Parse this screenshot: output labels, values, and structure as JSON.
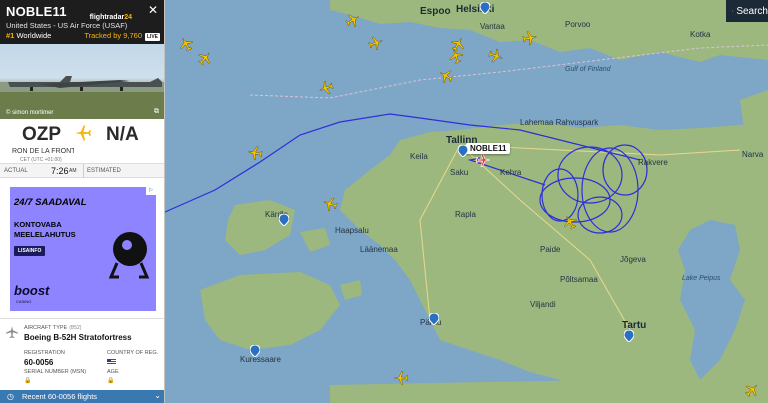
{
  "panel": {
    "callsign": "NOBLE11",
    "operator": "United States - US Air Force (USAF)",
    "rank_prefix": "#1",
    "rank_label": "Worldwide",
    "tracked_text": "Tracked by 9,760",
    "live_label": "LIVE",
    "logo_top": "flightradar",
    "logo_num": "24",
    "photo_credit": "© simon mortimer",
    "from_iata": "OZP",
    "to_iata": "N/A",
    "from_airport": "RON DE LA FRONT",
    "from_tz": "CET (UTC +01:00)",
    "actual_label": "ACTUAL",
    "actual_time": "7:26",
    "actual_ampm": "AM",
    "estimated_label": "ESTIMATED",
    "aircraft_type_label": "AIRCRAFT TYPE",
    "aircraft_type_code": "(B52)",
    "aircraft_type": "Boeing B-52H Stratofortress",
    "registration_label": "REGISTRATION",
    "registration": "60-0056",
    "country_label": "COUNTRY OF REG.",
    "serial_label": "SERIAL NUMBER (MSN)",
    "age_label": "AGE",
    "recent_label": "Recent 60-0056 flights"
  },
  "ad": {
    "line1": "24/7 SAADAVAL",
    "line2": "KONTOVABA",
    "line3": "MEELELAHUTUS",
    "button": "LISAINFO",
    "brand": "boost",
    "brand_sub": "CASINO"
  },
  "map": {
    "search_label": "Search",
    "flight_tag": "NOBLE11",
    "labels": [
      {
        "t": "Espoo",
        "c": "city"
      },
      {
        "t": "Helsinki",
        "c": "city"
      },
      {
        "t": "Tallinn",
        "c": "city"
      },
      {
        "t": "Tartu",
        "c": "city"
      },
      {
        "t": "Vantaa",
        "c": ""
      },
      {
        "t": "Porvoo",
        "c": ""
      },
      {
        "t": "Kotka",
        "c": ""
      },
      {
        "t": "Narva",
        "c": ""
      },
      {
        "t": "Rakvere",
        "c": ""
      },
      {
        "t": "Paide",
        "c": ""
      },
      {
        "t": "Viljandi",
        "c": ""
      },
      {
        "t": "Pärnu",
        "c": ""
      },
      {
        "t": "Kärdla",
        "c": ""
      },
      {
        "t": "Haapsalu",
        "c": ""
      },
      {
        "t": "Rapla",
        "c": ""
      },
      {
        "t": "Jõgeva",
        "c": ""
      },
      {
        "t": "Põltsamaa",
        "c": ""
      },
      {
        "t": "Kuressaare",
        "c": ""
      },
      {
        "t": "Läänemaa",
        "c": ""
      },
      {
        "t": "Gulf of Finland",
        "c": "sea"
      },
      {
        "t": "Lake Peipus",
        "c": "sea"
      },
      {
        "t": "Lahemaa Rahvuspark",
        "c": ""
      },
      {
        "t": "Keila",
        "c": ""
      },
      {
        "t": "Saku",
        "c": ""
      },
      {
        "t": "Kehra",
        "c": ""
      }
    ]
  },
  "colors": {
    "track": "#2d2fd8",
    "panel_header": "#1d1d1d",
    "accent_yellow": "#f6b50c",
    "recent_bar": "#3a78b2"
  }
}
